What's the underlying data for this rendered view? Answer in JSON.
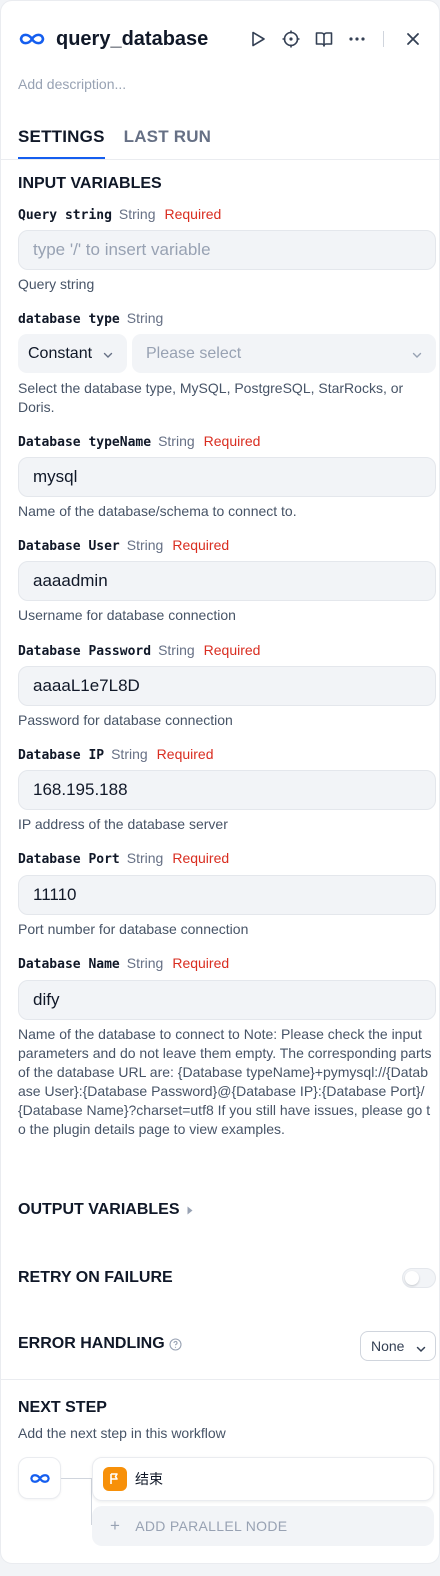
{
  "node": {
    "title": "query_database",
    "description_placeholder": "Add description..."
  },
  "tabs": [
    "SETTINGS",
    "LAST RUN"
  ],
  "input_variables": {
    "title": "INPUT VARIABLES",
    "query_string": {
      "name": "Query string",
      "type": "String",
      "required": "Required",
      "placeholder": "type '/' to insert variable",
      "help": "Query string"
    },
    "database_type": {
      "name": "database type",
      "type": "String",
      "mode": "Constant",
      "placeholder": "Please select",
      "help": "Select the database type, MySQL, PostgreSQL, StarRocks, or Doris."
    },
    "database_type_name": {
      "name": "Database typeName",
      "type": "String",
      "required": "Required",
      "value": "mysql",
      "help": "Name of the database/schema to connect to."
    },
    "database_user": {
      "name": "Database User",
      "type": "String",
      "required": "Required",
      "value": "aaaadmin",
      "help": "Username for database connection"
    },
    "database_password": {
      "name": "Database Password",
      "type": "String",
      "required": "Required",
      "value": "aaaaL1e7L8D",
      "help": "Password for database connection"
    },
    "database_ip": {
      "name": "Database IP",
      "type": "String",
      "required": "Required",
      "value": "168.195.188",
      "help": "IP address of the database server"
    },
    "database_port": {
      "name": "Database Port",
      "type": "String",
      "required": "Required",
      "value": "11110",
      "help": "Port number for database connection"
    },
    "database_name": {
      "name": "Database Name",
      "type": "String",
      "required": "Required",
      "value": "dify",
      "help": "Name of the database to connect to Note: Please check the input parameters and do not leave them empty. The corresponding parts of the database URL are: {Database typeName}+pymysql://{Database User}:{Database Password}@{Database IP}:{Database Port}/{Database Name}?charset=utf8 If you still have issues, please go to the plugin details page to view examples."
    }
  },
  "output_variables": {
    "title": "OUTPUT VARIABLES"
  },
  "retry": {
    "title": "RETRY ON FAILURE",
    "enabled": false
  },
  "error_handling": {
    "title": "ERROR HANDLING",
    "value": "None"
  },
  "next_step": {
    "title": "NEXT STEP",
    "subtitle": "Add the next step in this workflow",
    "end_node_label": "结束",
    "add_parallel_label": "ADD PARALLEL NODE"
  },
  "colors": {
    "accent": "#155eef",
    "required": "#d92d20",
    "end_node": "#f79009"
  }
}
